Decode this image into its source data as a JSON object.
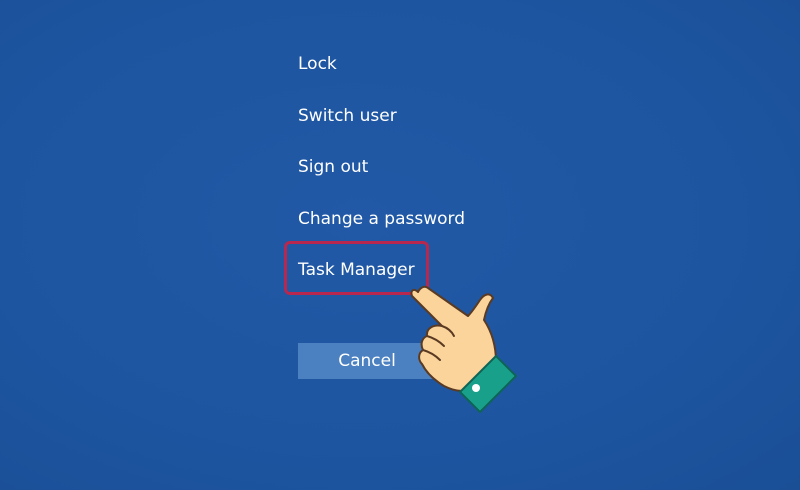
{
  "security_menu": {
    "items": [
      {
        "label": "Lock"
      },
      {
        "label": "Switch user"
      },
      {
        "label": "Sign out"
      },
      {
        "label": "Change a password"
      },
      {
        "label": "Task Manager",
        "highlighted": true
      }
    ],
    "cancel_label": "Cancel"
  },
  "colors": {
    "background": "#1d55a0",
    "text": "#ffffff",
    "cancel_button": "#4b81c1",
    "highlight_border": "#b8284e",
    "hand_skin": "#fbd49b",
    "sleeve": "#19a08a"
  },
  "icons": {
    "pointer": "pointing-hand-icon"
  }
}
